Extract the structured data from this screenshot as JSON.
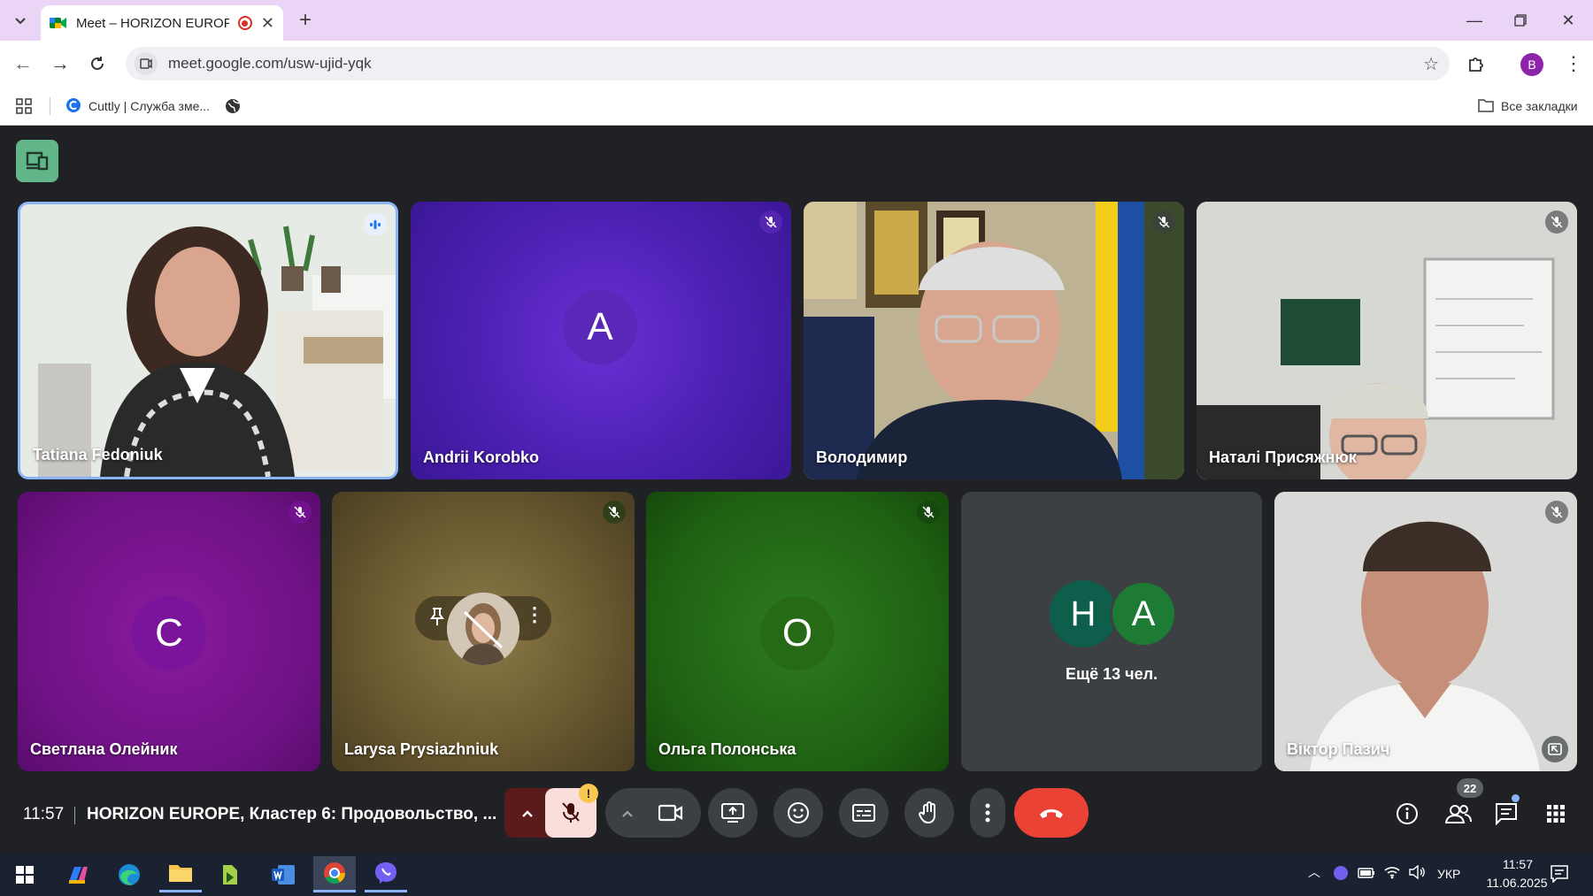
{
  "browser": {
    "tab_title": "Meet – HORIZON EUROPE,",
    "url": "meet.google.com/usw-ujid-yqk",
    "profile_initial": "B",
    "bookmarks": [
      {
        "label": "Cuttly | Служба зме..."
      }
    ],
    "all_bookmarks_label": "Все закладки"
  },
  "meet": {
    "participants": [
      {
        "name": "Tatiana Fedoniuk",
        "status": "speaking",
        "type": "video"
      },
      {
        "name": "Andrii Korobko",
        "initial": "A",
        "status": "muted",
        "type": "avatar"
      },
      {
        "name": "Володимир",
        "status": "muted",
        "type": "video"
      },
      {
        "name": "Наталі Присяжнюк",
        "status": "muted",
        "type": "video"
      },
      {
        "name": "Светлана Олейник",
        "initial": "С",
        "status": "muted",
        "type": "avatar"
      },
      {
        "name": "Larysa Prysiazhniuk",
        "status": "muted",
        "type": "self"
      },
      {
        "name": "Ольга Полонська",
        "initial": "О",
        "status": "muted",
        "type": "avatar"
      },
      {
        "name": "Віктор Пазич",
        "status": "muted",
        "type": "video"
      }
    ],
    "overflow": {
      "initials": [
        "Н",
        "А"
      ],
      "label": "Ещё 13 чел."
    },
    "time": "11:57",
    "meeting_title": "HORIZON EUROPE, Кластер 6: Продовольство, ...",
    "participant_count": "22",
    "warning_badge": "!"
  },
  "taskbar": {
    "language": "УКР",
    "time": "11:57",
    "date": "11.06.2025"
  },
  "colors": {
    "tab_strip": "#ead5f6",
    "end_call": "#ea4335",
    "mic_off": "#f9dedc",
    "meet_bg": "#202124"
  }
}
